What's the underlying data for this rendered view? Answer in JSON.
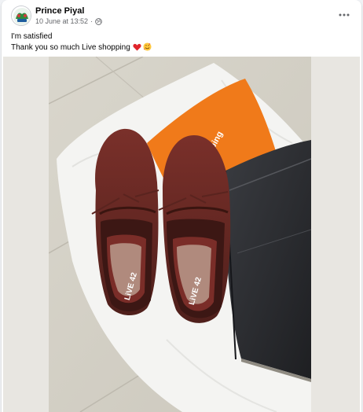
{
  "post": {
    "author": "Prince Piyal",
    "date": "10 June at 13:52",
    "separator": "·",
    "privacy_icon": "globe-icon",
    "more_icon": "more-options-icon",
    "line1": "I'm satisfied",
    "line2": "Thank you so much Live shopping",
    "emojis": [
      "red-heart",
      "smiling-face-with-hearts"
    ]
  },
  "photo": {
    "bag_text": "Live Shopping",
    "left_shoe_insole": "LiVE 42",
    "right_shoe_insole": "LiVE 42"
  },
  "colors": {
    "link": "#050505",
    "secondary_text": "#65676b",
    "bag_orange": "#f07a1a",
    "shoe_suede": "#6b2a25",
    "box": "#2b2d31"
  }
}
